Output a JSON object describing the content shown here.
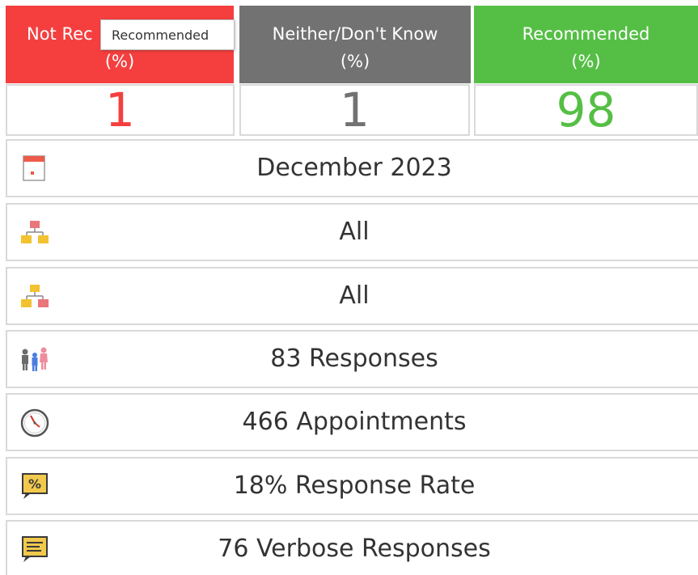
{
  "colors": {
    "not_recommended": "#f53f3f",
    "neither": "#727272",
    "recommended": "#55bf45"
  },
  "columns": [
    {
      "line1": "Not Rec",
      "line2": "(%)",
      "value": "1"
    },
    {
      "line1": "Neither/Don't Know",
      "line2": "(%)",
      "value": "1"
    },
    {
      "line1": "Recommended",
      "line2": "(%)",
      "value": "98"
    }
  ],
  "tooltip": "Recommended",
  "rows": [
    {
      "icon": "calendar-icon",
      "text": "December 2023"
    },
    {
      "icon": "hierarchy-icon",
      "text": "All"
    },
    {
      "icon": "hierarchy-icon",
      "text": "All"
    },
    {
      "icon": "people-icon",
      "text": "83 Responses"
    },
    {
      "icon": "clock-icon",
      "text": "466 Appointments"
    },
    {
      "icon": "percent-speech-icon",
      "text": "18% Response Rate"
    },
    {
      "icon": "note-speech-icon",
      "text": "76 Verbose Responses"
    }
  ]
}
